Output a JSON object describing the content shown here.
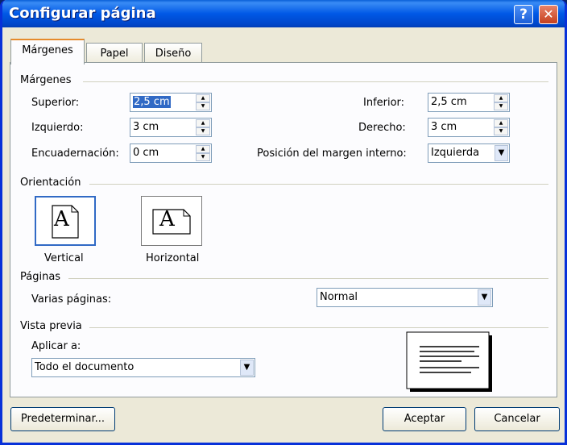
{
  "window": {
    "title": "Configurar página"
  },
  "tabs": [
    "Márgenes",
    "Papel",
    "Diseño"
  ],
  "margins": {
    "section": "Márgenes",
    "top_label": "Superior:",
    "top_value": "2,5 cm",
    "bottom_label": "Inferior:",
    "bottom_value": "2,5 cm",
    "left_label": "Izquierdo:",
    "left_value": "3 cm",
    "right_label": "Derecho:",
    "right_value": "3 cm",
    "gutter_label": "Encuadernación:",
    "gutter_value": "0 cm",
    "gutter_pos_label": "Posición del margen interno:",
    "gutter_pos_value": "Izquierda"
  },
  "orientation": {
    "section": "Orientación",
    "portrait_label": "Vertical",
    "landscape_label": "Horizontal",
    "icon_letter": "A",
    "selected": "Vertical"
  },
  "pages": {
    "section": "Páginas",
    "multiple_label": "Varias páginas:",
    "multiple_value": "Normal"
  },
  "preview": {
    "section": "Vista previa",
    "apply_label": "Aplicar a:",
    "apply_value": "Todo el documento"
  },
  "buttons": {
    "default": "Predeterminar...",
    "ok": "Aceptar",
    "cancel": "Cancelar"
  }
}
